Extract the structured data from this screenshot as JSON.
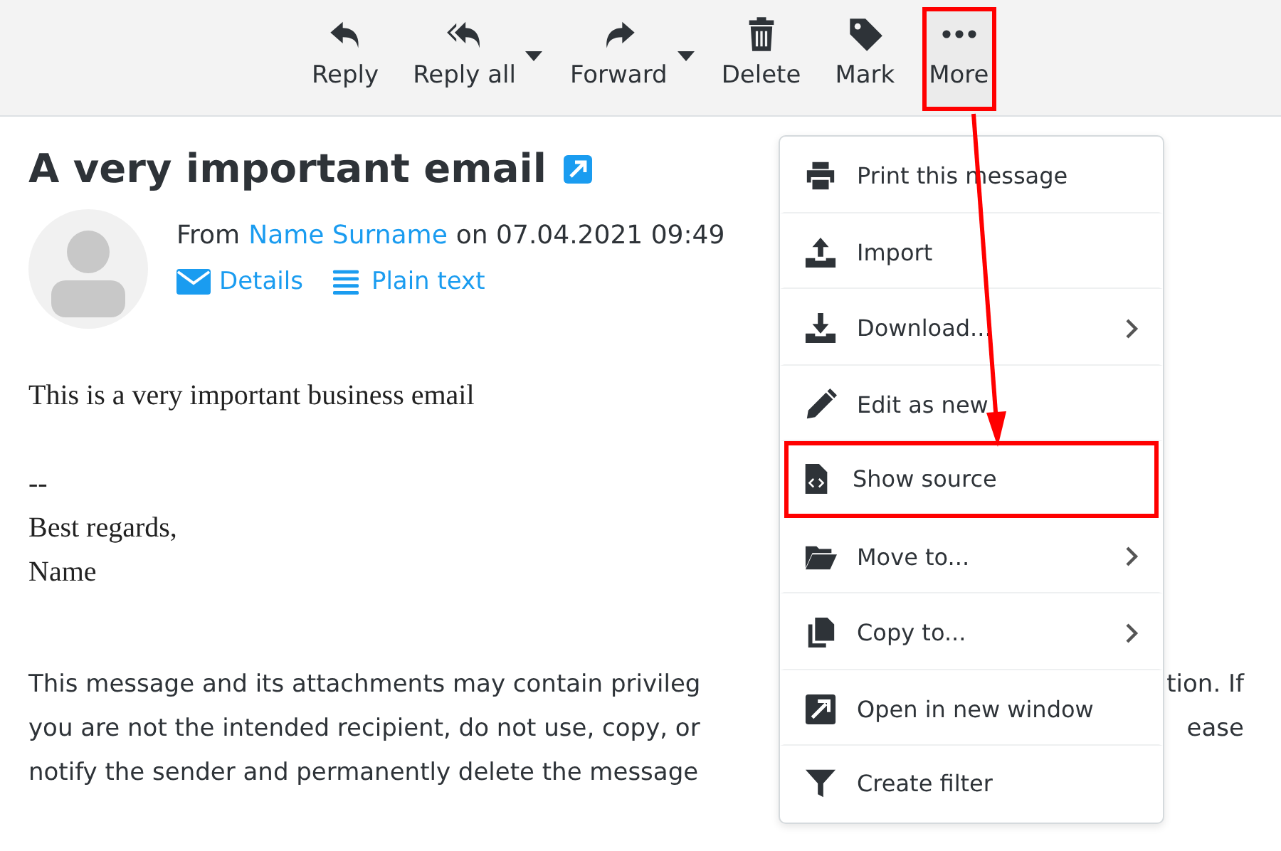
{
  "toolbar": [
    {
      "kind": "reply",
      "label": "Reply",
      "dropdown": false,
      "highlighted": false
    },
    {
      "kind": "reply-all",
      "label": "Reply all",
      "dropdown": true,
      "highlighted": false
    },
    {
      "kind": "forward",
      "label": "Forward",
      "dropdown": true,
      "highlighted": false
    },
    {
      "kind": "delete",
      "label": "Delete",
      "dropdown": false,
      "highlighted": false
    },
    {
      "kind": "mark",
      "label": "Mark",
      "dropdown": false,
      "highlighted": false
    },
    {
      "kind": "more",
      "label": "More",
      "dropdown": false,
      "highlighted": true
    }
  ],
  "message": {
    "subject": "A very important email",
    "from_label": "From",
    "sender": "Name Surname",
    "date_text": "on 07.04.2021 09:49",
    "links": [
      {
        "kind": "details",
        "label": "Details"
      },
      {
        "kind": "plain",
        "label": "Plain text"
      }
    ],
    "body": [
      [
        "This is a very important business email"
      ],
      [
        "--",
        "Best regards,",
        "Name"
      ]
    ],
    "disclaimer": [
      {
        "left": "This message and its attachments may contain privileg",
        "right": "tion. If"
      },
      {
        "left": "you are not the intended recipient, do not use, copy, or",
        "right": "ease"
      },
      {
        "left": "notify the sender and permanently delete the message"
      }
    ]
  },
  "menu": [
    {
      "kind": "print",
      "label": "Print this message",
      "submenu": false,
      "highlighted": false
    },
    {
      "kind": "import",
      "label": "Import",
      "submenu": false,
      "highlighted": false
    },
    {
      "kind": "download",
      "label": "Download...",
      "submenu": true,
      "highlighted": false
    },
    {
      "kind": "edit",
      "label": "Edit as new",
      "submenu": false,
      "highlighted": false
    },
    {
      "kind": "source",
      "label": "Show source",
      "submenu": false,
      "highlighted": true
    },
    {
      "kind": "move",
      "label": "Move to...",
      "submenu": true,
      "highlighted": false
    },
    {
      "kind": "copy",
      "label": "Copy to...",
      "submenu": true,
      "highlighted": false
    },
    {
      "kind": "open",
      "label": "Open in new window",
      "submenu": false,
      "highlighted": false
    },
    {
      "kind": "filter",
      "label": "Create filter",
      "submenu": false,
      "highlighted": false
    }
  ]
}
